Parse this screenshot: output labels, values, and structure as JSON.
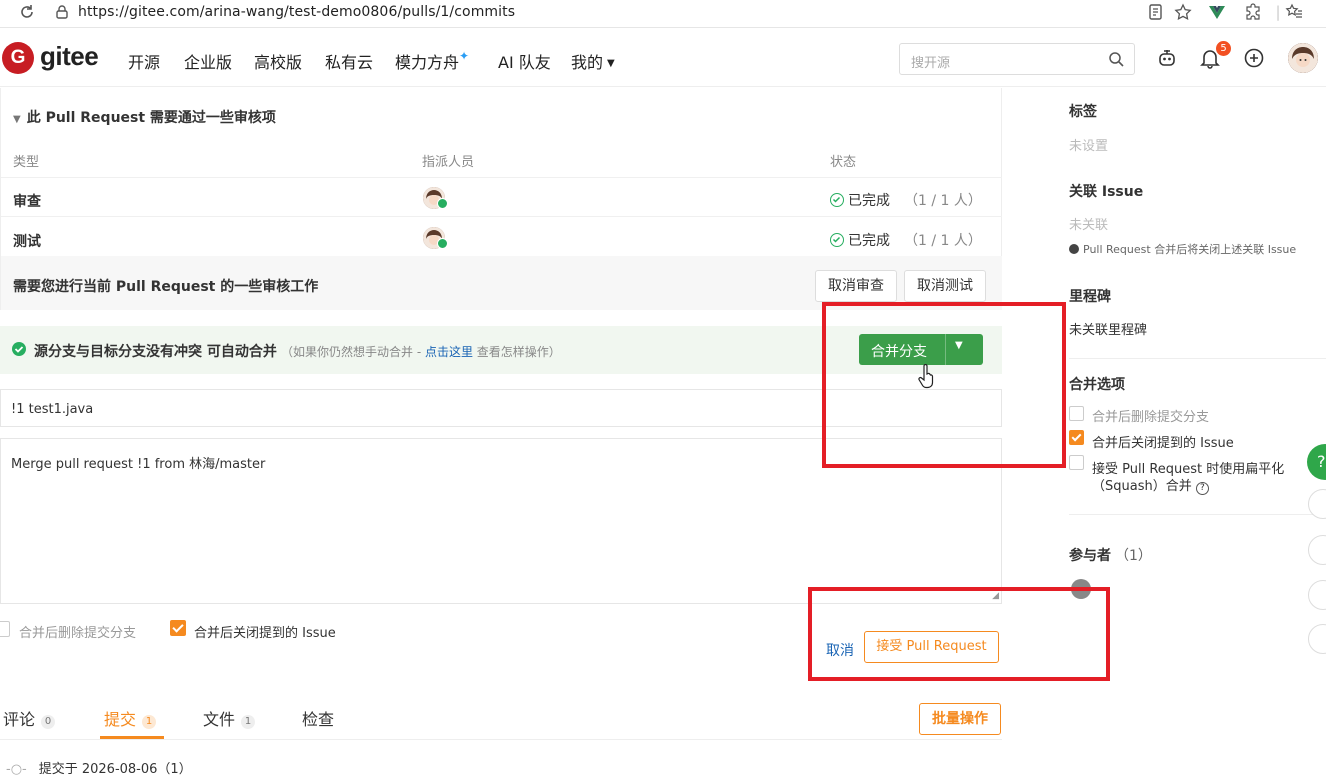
{
  "browser": {
    "url": "https://gitee.com/arina-wang/test-demo0806/pulls/1/commits"
  },
  "header": {
    "logo_text": "gitee",
    "logo_letter": "G",
    "nav": [
      "开源",
      "企业版",
      "高校版",
      "私有云",
      "模力方舟",
      "AI 队友",
      "我的"
    ],
    "search_placeholder": "搜开源",
    "notification_count": "5"
  },
  "review": {
    "title": "此 Pull Request 需要通过一些审核项",
    "columns": [
      "类型",
      "指派人员",
      "状态"
    ],
    "rows": [
      {
        "type": "审查",
        "status": "已完成",
        "count": "（1 / 1 人）"
      },
      {
        "type": "测试",
        "status": "已完成",
        "count": "（1 / 1 人）"
      }
    ],
    "need_text": "需要您进行当前 Pull Request 的一些审核工作",
    "cancel_review": "取消审查",
    "cancel_test": "取消测试"
  },
  "merge": {
    "status_text": "源分支与目标分支没有冲突 可自动合并",
    "hint_prefix": "（如果你仍然想手动合并 - ",
    "hint_link": "点击这里",
    "hint_suffix": " 查看怎样操作）",
    "merge_button": "合并分支"
  },
  "form": {
    "title_value": "!1 test1.java",
    "body_value": "Merge pull request !1 from 林海/master",
    "opt_delete_branch": "合并后删除提交分支",
    "opt_close_issue": "合并后关闭提到的 Issue",
    "cancel": "取消",
    "accept": "接受 Pull Request"
  },
  "tabs": [
    {
      "label": "评论",
      "count": "0"
    },
    {
      "label": "提交",
      "count": "1"
    },
    {
      "label": "文件",
      "count": "1"
    },
    {
      "label": "检查",
      "count": ""
    }
  ],
  "batch_button": "批量操作",
  "commit_date": "提交于 2026-08-06（1）",
  "sidebar": {
    "labels_head": "标签",
    "labels_value": "未设置",
    "issue_head": "关联 Issue",
    "issue_value": "未关联",
    "issue_note": "Pull Request 合并后将关闭上述关联 Issue",
    "milestone_head": "里程碑",
    "milestone_value": "未关联里程碑",
    "merge_opts_head": "合并选项",
    "opt1": "合并后删除提交分支",
    "opt2": "合并后关闭提到的 Issue",
    "opt3_line1": "接受 Pull Request 时使用扁平化",
    "opt3_line2": "（Squash）合并",
    "participants_head": "参与者",
    "participants_count": "（1）"
  },
  "colors": {
    "accent": "#f58a1f",
    "merge_green": "#3b9e4a",
    "highlight_red": "#e41e26",
    "brand_red": "#c71d23"
  },
  "icons": [
    "reload-icon",
    "lock-icon",
    "search-icon",
    "bell-icon",
    "plus-icon",
    "gear-icon",
    "check-circle-icon",
    "chevron-down-icon"
  ]
}
